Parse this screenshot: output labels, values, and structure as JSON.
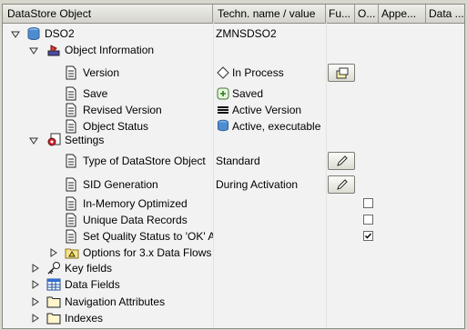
{
  "columns": {
    "object": "DataStore Object",
    "techname": "Techn. name / value",
    "fu": "Fu...",
    "o": "O...",
    "appe": "Appe...",
    "data": "Data ..."
  },
  "tree": {
    "root": {
      "label": "DSO2",
      "value": "ZMNSDSO2"
    },
    "object_information": {
      "label": "Object Information",
      "version": {
        "label": "Version",
        "value": "In Process"
      },
      "save": {
        "label": "Save",
        "value": "Saved"
      },
      "revised_version": {
        "label": "Revised Version",
        "value": "Active Version"
      },
      "object_status": {
        "label": "Object Status",
        "value": "Active, executable"
      }
    },
    "settings": {
      "label": "Settings",
      "type": {
        "label": "Type of DataStore Object",
        "value": "Standard"
      },
      "sid_generation": {
        "label": "SID Generation",
        "value": "During Activation"
      },
      "in_memory": {
        "label": "In-Memory Optimized",
        "checked": false
      },
      "unique_records": {
        "label": "Unique Data Records",
        "checked": false
      },
      "quality_status": {
        "label": "Set Quality Status to 'OK' A",
        "checked": true
      },
      "options_3x": {
        "label": "Options for 3.x Data Flows"
      }
    },
    "key_fields": {
      "label": "Key fields"
    },
    "data_fields": {
      "label": "Data Fields"
    },
    "navigation_attributes": {
      "label": "Navigation Attributes"
    },
    "indexes": {
      "label": "Indexes"
    }
  },
  "colors": {
    "frame_bg": "#f2f2f2",
    "header_bg": "#d4d4cc",
    "window_bg": "#d7d7ce"
  }
}
